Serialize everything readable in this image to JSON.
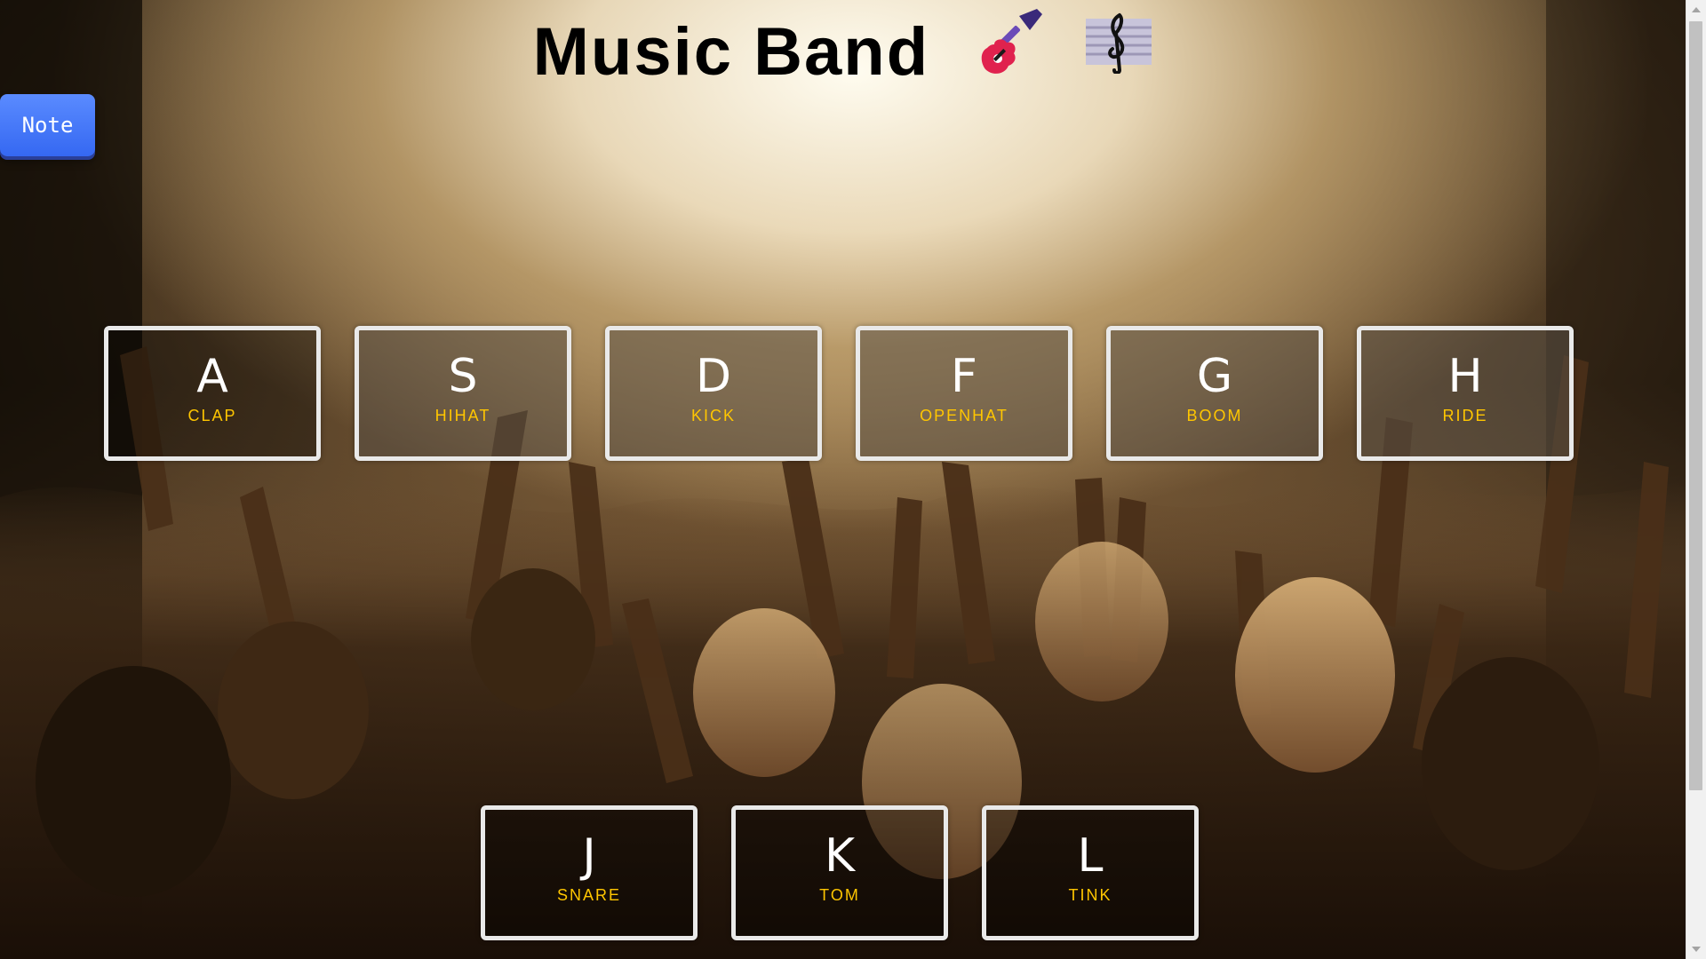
{
  "header": {
    "title": "Music Band",
    "icons": [
      "guitar-icon",
      "musical-score-icon"
    ]
  },
  "note_button": {
    "label": "Note"
  },
  "keys": [
    {
      "letter": "A",
      "sound": "CLAP"
    },
    {
      "letter": "S",
      "sound": "HIHAT"
    },
    {
      "letter": "D",
      "sound": "KICK"
    },
    {
      "letter": "F",
      "sound": "OPENHAT"
    },
    {
      "letter": "G",
      "sound": "BOOM"
    },
    {
      "letter": "H",
      "sound": "RIDE"
    },
    {
      "letter": "J",
      "sound": "SNARE"
    },
    {
      "letter": "K",
      "sound": "TOM"
    },
    {
      "letter": "L",
      "sound": "TINK"
    }
  ],
  "colors": {
    "sound_label": "#ffc600",
    "key_border": "#e9e9e9",
    "note_button": "#3568f2"
  }
}
